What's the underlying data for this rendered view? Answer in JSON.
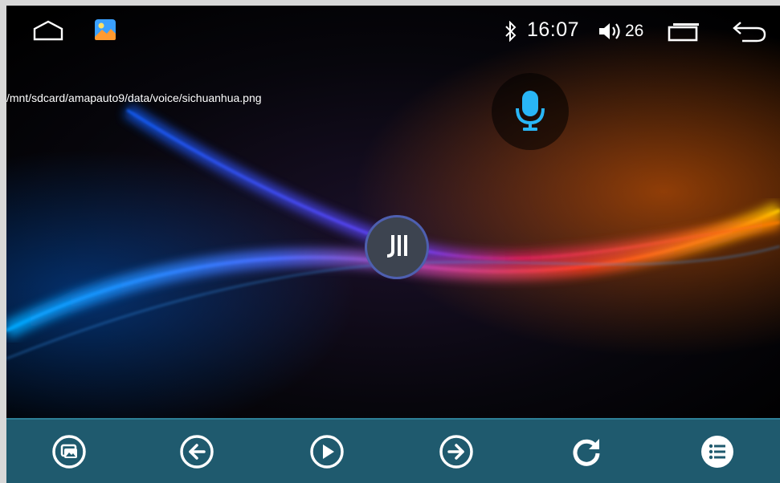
{
  "status_bar": {
    "time": "16:07",
    "volume_level": "26",
    "icons": [
      "home-icon",
      "gallery-app-icon",
      "bluetooth-icon",
      "volume-icon",
      "recent-apps-icon",
      "back-icon"
    ]
  },
  "viewer": {
    "file_path": "/mnt/sdcard/amapauto9/data/voice/sichuanhua.png",
    "center_button_icon": "brand-logo-icon",
    "voice_button_icon": "microphone-icon"
  },
  "toolbar": {
    "buttons": [
      "slideshow-icon",
      "previous-icon",
      "play-icon",
      "next-icon",
      "rotate-icon",
      "list-icon"
    ]
  },
  "colors": {
    "toolbar_bg": "#1f5a6e",
    "icon_accent": "#29b6f6"
  }
}
